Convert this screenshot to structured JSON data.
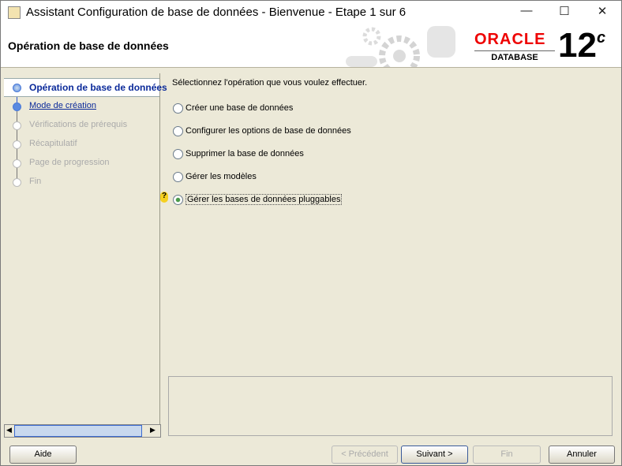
{
  "window": {
    "title": "Assistant Configuration de base de données - Bienvenue - Etape 1 sur 6",
    "minimize": "—",
    "maximize": "☐",
    "close": "✕"
  },
  "header": {
    "title": "Opération de base de données",
    "logo_brand": "ORACLE",
    "logo_product": "DATABASE",
    "logo_version": "12",
    "logo_version_suffix": "c"
  },
  "steps": [
    {
      "label": "Opération de base de données",
      "state": "current"
    },
    {
      "label": "Mode de création",
      "state": "next-link"
    },
    {
      "label": "Vérifications de prérequis",
      "state": "disabled"
    },
    {
      "label": "Récapitulatif",
      "state": "disabled"
    },
    {
      "label": "Page de progression",
      "state": "disabled"
    },
    {
      "label": "Fin",
      "state": "disabled"
    }
  ],
  "main": {
    "prompt": "Sélectionnez l'opération que vous voulez effectuer.",
    "options": [
      {
        "label": "Créer une base de données",
        "selected": false
      },
      {
        "label": "Configurer les options de base de données",
        "selected": false
      },
      {
        "label": "Supprimer la base de données",
        "selected": false
      },
      {
        "label": "Gérer les modèles",
        "selected": false
      },
      {
        "label": "Gérer les bases de données pluggables",
        "selected": true
      }
    ]
  },
  "buttons": {
    "help": "Aide",
    "back": "< Précédent",
    "next": "Suivant >",
    "finish": "Fin",
    "cancel": "Annuler"
  },
  "colors": {
    "accent": "#0b2a9a",
    "oracle_red": "#e00000",
    "background": "#ece9d8"
  }
}
